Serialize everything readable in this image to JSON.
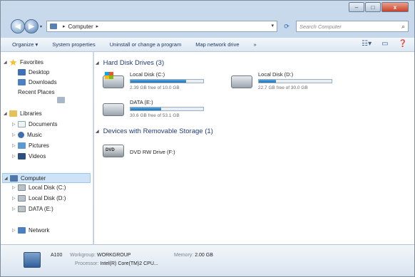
{
  "window": {
    "buttons": {
      "minimize": "–",
      "maximize": "□",
      "close": "x"
    }
  },
  "address": {
    "crumbs": [
      "Computer"
    ],
    "separator": "▸",
    "search_placeholder": "Search Computer"
  },
  "toolbar": {
    "organize": "Organize ▾",
    "system_properties": "System properties",
    "uninstall": "Uninstall or change a program",
    "map_drive": "Map network drive",
    "more": "»"
  },
  "nav": {
    "favorites": "Favorites",
    "desktop": "Desktop",
    "downloads": "Downloads",
    "recent_places": "Recent Places",
    "libraries": "Libraries",
    "documents": "Documents",
    "music": "Music",
    "pictures": "Pictures",
    "videos": "Videos",
    "computer": "Computer",
    "local_c": "Local Disk (C:)",
    "local_d": "Local Disk (D:)",
    "data_e": "DATA (E:)",
    "network": "Network"
  },
  "groups": {
    "hdd": "Hard Disk Drives (3)",
    "removable": "Devices with Removable Storage (1)"
  },
  "drives": [
    {
      "name": "Local Disk (C:)",
      "free": "2.39 GB free of 10.0 GB",
      "used_fraction": 0.76
    },
    {
      "name": "Local Disk (D:)",
      "free": "22.7 GB free of 30.0 GB",
      "used_fraction": 0.24
    },
    {
      "name": "DATA (E:)",
      "free": "30.6 GB free of 53.1 GB",
      "used_fraction": 0.42
    }
  ],
  "dvd": {
    "name": "DVD RW Drive (F:)"
  },
  "details": {
    "computer_name": "A100",
    "workgroup_label": "Workgroup:",
    "workgroup": "WORKGROUP",
    "memory_label": "Memory:",
    "memory": "2.00 GB",
    "processor_label": "Processor:",
    "processor": "Intel(R) Core(TM)2 CPU..."
  }
}
